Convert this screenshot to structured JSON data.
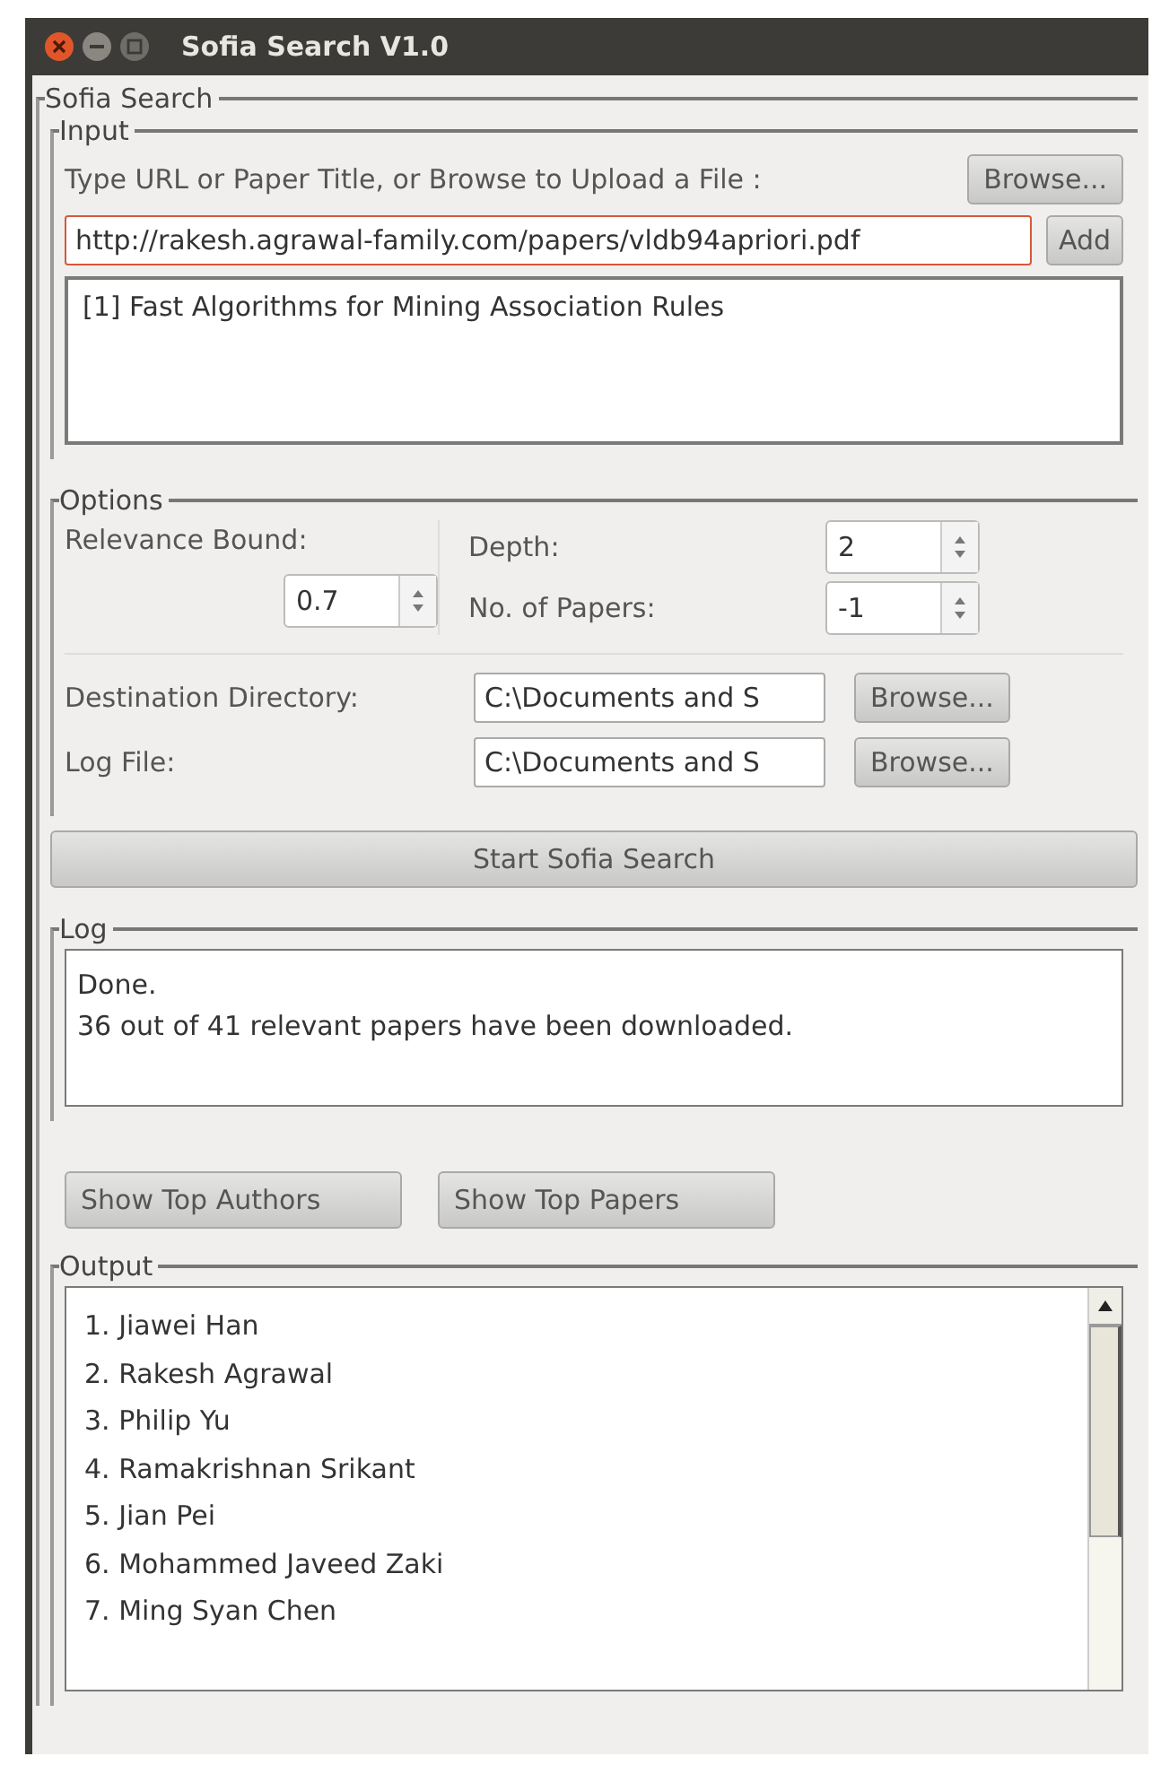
{
  "window": {
    "title": "Sofia Search V1.0"
  },
  "main_group": {
    "label": "Sofia Search"
  },
  "input": {
    "label": "Input",
    "prompt": "Type URL or Paper Title, or Browse to Upload a File :",
    "browse_button": "Browse...",
    "url_field": {
      "value": "http://rakesh.agrawal-family.com/papers/vldb94apriori.pdf"
    },
    "add_button": "Add",
    "papers": [
      "[1] Fast Algorithms for Mining Association Rules"
    ]
  },
  "options": {
    "label": "Options",
    "relevance": {
      "label": "Relevance Bound:",
      "value": "0.7"
    },
    "depth": {
      "label": "Depth:",
      "value": "2"
    },
    "papers": {
      "label": "No. of Papers:",
      "value": "-1"
    },
    "destination": {
      "label": "Destination Directory:",
      "value": "C:\\Documents and S",
      "browse_button": "Browse..."
    },
    "log_file": {
      "label": "Log File:",
      "value": "C:\\Documents and S",
      "browse_button": "Browse..."
    }
  },
  "start_button": "Start Sofia Search",
  "log": {
    "label": "Log",
    "lines": [
      "Done.",
      "36 out of 41 relevant papers have been downloaded."
    ]
  },
  "buttons": [
    "Show Top Authors",
    "Show Top Papers"
  ],
  "output": {
    "label": "Output",
    "items": [
      "1. Jiawei Han",
      "2. Rakesh Agrawal",
      "3. Philip Yu",
      "4. Ramakrishnan Srikant",
      "5. Jian Pei",
      "6. Mohammed Javeed Zaki",
      "7. Ming Syan Chen"
    ]
  }
}
